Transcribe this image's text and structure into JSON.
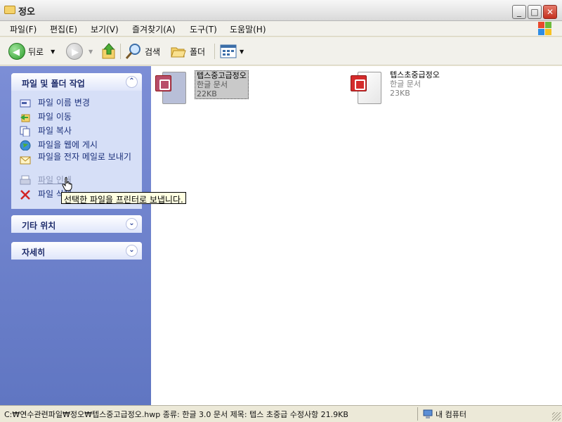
{
  "window": {
    "title": "정오"
  },
  "window_controls": {
    "minimize": "_",
    "maximize": "□",
    "close": "✕"
  },
  "menu": [
    "파일(F)",
    "편집(E)",
    "보기(V)",
    "즐겨찾기(A)",
    "도구(T)",
    "도움말(H)"
  ],
  "toolbar": {
    "back": "뒤로",
    "search": "검색",
    "folders": "폴더"
  },
  "tasks": {
    "title": "파일 및 폴더 작업",
    "items": [
      "파일 이름 변경",
      "파일 이동",
      "파일 복사",
      "파일을 웹에 게시",
      "파일을 전자 메일로 보내기",
      "파일 인쇄",
      "파일 삭제"
    ]
  },
  "other_places": {
    "title": "기타 위치"
  },
  "details": {
    "title": "자세히"
  },
  "files": [
    {
      "name": "텝스중고급정오",
      "type": "한글 문서",
      "size": "22KB",
      "selected": true
    },
    {
      "name": "텝스초중급정오",
      "type": "한글 문서",
      "size": "23KB",
      "selected": false
    }
  ],
  "tooltip": "선택한 파일을 프린터로 보냅니다.",
  "status": {
    "path": "C:₩연수관련파일₩정오₩텝스중고급정오.hwp 종류: 한글 3.0 문서 제목: 텝스 초중급 수정사항 21.9KB",
    "computer": "내 컴퓨터"
  },
  "colors": {
    "titlebar": "#e3e3e3",
    "task_pane": "#6d80c9",
    "task_body": "#d6dff7",
    "link": "#1a2f7a"
  }
}
